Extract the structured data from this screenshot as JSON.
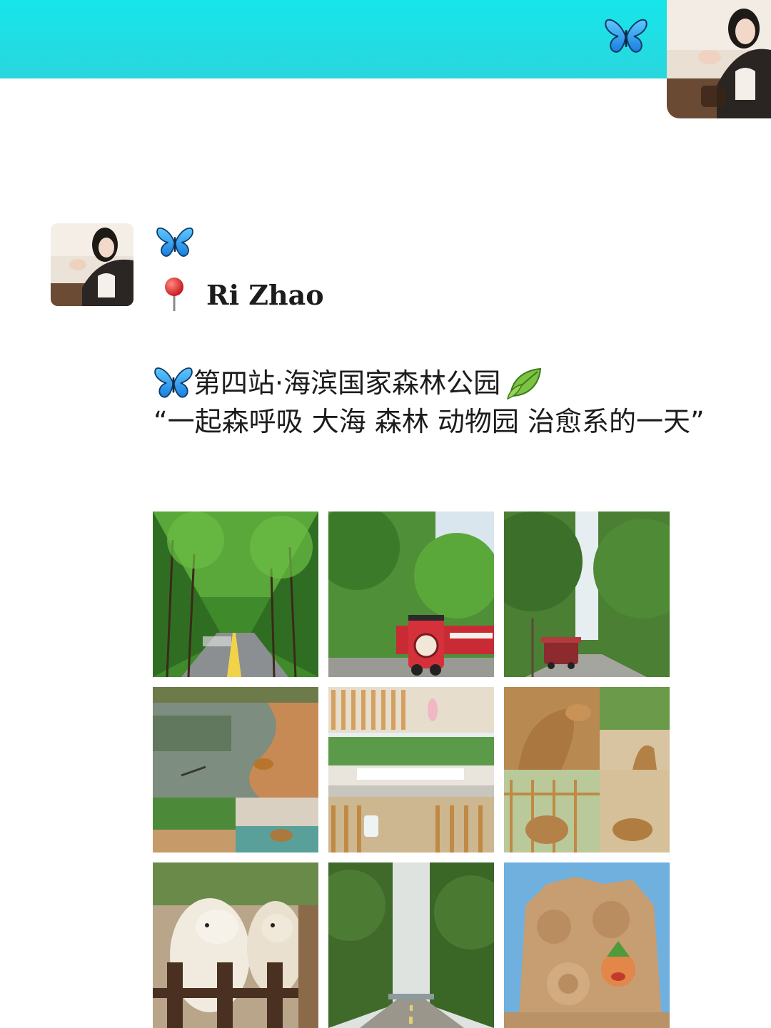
{
  "header": {
    "butterfly_icon": "blue-butterfly-emoji",
    "accent_color": "#1ee0e6"
  },
  "post": {
    "location_pin_icon": "round-pushpin-emoji",
    "location": "Ri Zhao",
    "caption_title": "第四站·海滨国家森林公园",
    "caption_body": "“一起森呼吸 大海 森林 动物园  治愈系的一天”"
  },
  "photos": [
    {
      "subject": "tree-lined-road"
    },
    {
      "subject": "red-tour-train"
    },
    {
      "subject": "tour-train-forest-road"
    },
    {
      "subject": "pond-and-animals"
    },
    {
      "subject": "park-entrance-collage"
    },
    {
      "subject": "deer-collage"
    },
    {
      "subject": "alpacas"
    },
    {
      "subject": "forest-path-to-sea"
    },
    {
      "subject": "sand-sculpture"
    }
  ]
}
